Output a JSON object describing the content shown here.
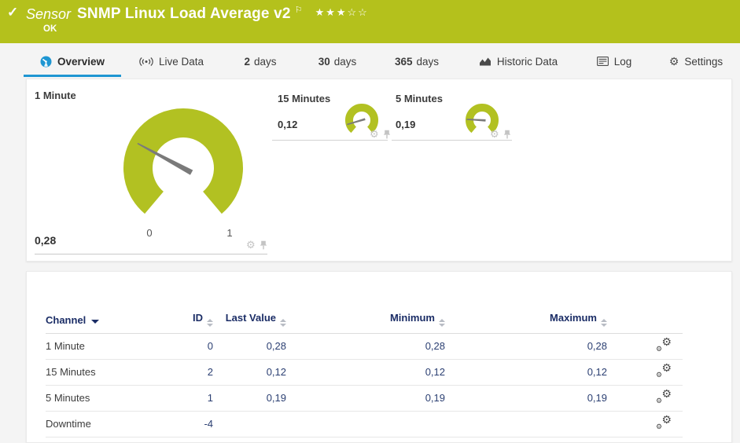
{
  "icons": {
    "check": "✓",
    "flag": "⚐",
    "gear": "⚙"
  },
  "colors": {
    "brand_green": "#b4c11c",
    "gauge_green": "#b2c122",
    "needle_gray": "#7a7a7a",
    "accent_blue": "#1e96d2",
    "navy": "#1b2d66"
  },
  "header": {
    "kind": "Sensor",
    "title": "SNMP Linux Load Average v2",
    "status": "OK",
    "stars": {
      "filled": 3,
      "total": 5
    }
  },
  "tabs": {
    "overview": {
      "label": "Overview"
    },
    "live_data": {
      "label": "Live Data"
    },
    "days2": {
      "num": "2",
      "label": "days"
    },
    "days30": {
      "num": "30",
      "label": "days"
    },
    "days365": {
      "num": "365",
      "label": "days"
    },
    "historic": {
      "label": "Historic Data"
    },
    "log": {
      "label": "Log"
    },
    "settings": {
      "label": "Settings"
    }
  },
  "gauges": [
    {
      "name": "1 Minute",
      "value_label": "0,28",
      "value": 0.28,
      "min": 0,
      "max": 1,
      "tick_low": "0",
      "tick_high": "1"
    },
    {
      "name": "15 Minutes",
      "value_label": "0,12",
      "value": 0.12,
      "min": 0,
      "max": 1
    },
    {
      "name": "5 Minutes",
      "value_label": "0,19",
      "value": 0.19,
      "min": 0,
      "max": 1
    }
  ],
  "chart_data": {
    "type": "gauge",
    "series": [
      {
        "name": "1 Minute",
        "value": 0.28,
        "range": [
          0,
          1
        ]
      },
      {
        "name": "15 Minutes",
        "value": 0.12,
        "range": [
          0,
          1
        ]
      },
      {
        "name": "5 Minutes",
        "value": 0.19,
        "range": [
          0,
          1
        ]
      }
    ]
  },
  "table": {
    "headers": {
      "channel": "Channel",
      "id": "ID",
      "last_value": "Last Value",
      "minimum": "Minimum",
      "maximum": "Maximum"
    },
    "rows": [
      {
        "channel": "1 Minute",
        "id": "0",
        "last": "0,28",
        "min": "0,28",
        "max": "0,28"
      },
      {
        "channel": "15 Minutes",
        "id": "2",
        "last": "0,12",
        "min": "0,12",
        "max": "0,12"
      },
      {
        "channel": "5 Minutes",
        "id": "1",
        "last": "0,19",
        "min": "0,19",
        "max": "0,19"
      },
      {
        "channel": "Downtime",
        "id": "-4",
        "last": "",
        "min": "",
        "max": ""
      }
    ]
  }
}
